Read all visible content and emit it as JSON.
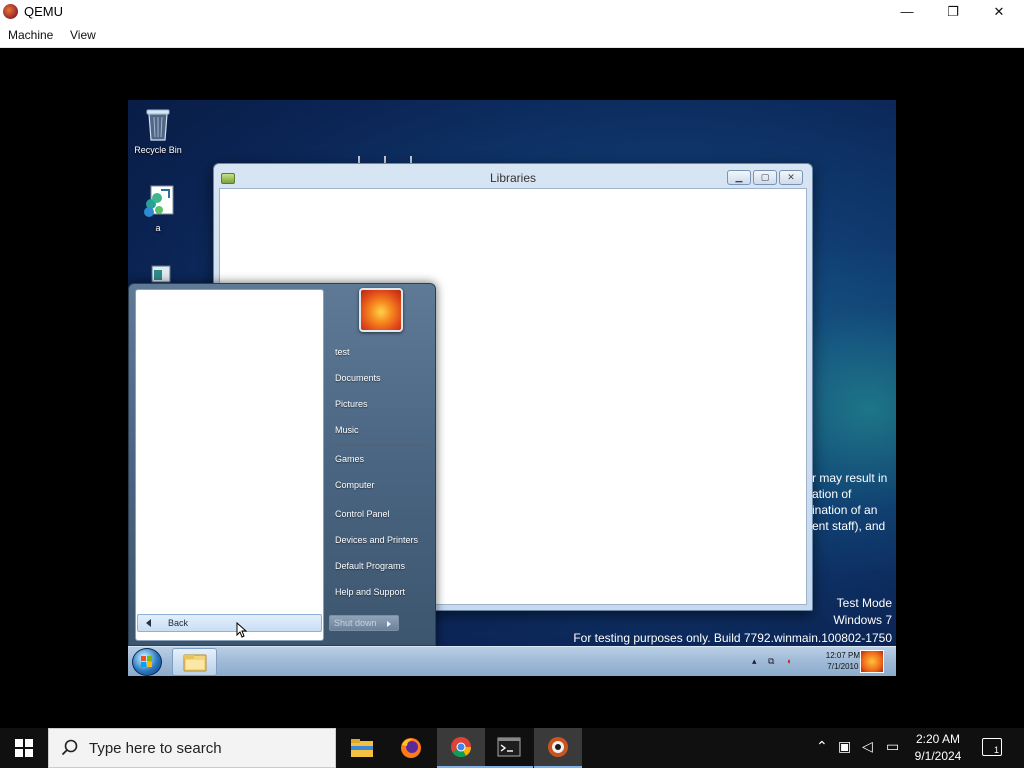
{
  "host_window": {
    "title": "QEMU",
    "menu": [
      "Machine",
      "View"
    ],
    "controls": {
      "minimize": "—",
      "restore": "❐",
      "close": "✕"
    }
  },
  "guest": {
    "desktop_icons": [
      {
        "label": "Recycle Bin",
        "icon": "recycle-bin-icon"
      },
      {
        "label": "a",
        "icon": "setup-package-icon"
      },
      {
        "label": "",
        "icon": "window-app-icon"
      }
    ],
    "libraries_window": {
      "title": "Libraries",
      "controls": {
        "minimize": "▁",
        "maximize": "▢",
        "close": "✕"
      }
    },
    "eula_lines": [
      "r may result in",
      "ation of",
      "ination of an",
      "ent staff), and"
    ],
    "watermark": {
      "line1": "Test Mode",
      "line2": "Windows 7",
      "line3": "For testing purposes only. Build 7792.winmain.100802-1750"
    },
    "start_menu": {
      "back_label": "Back",
      "items": [
        "test",
        "Documents",
        "Pictures",
        "Music",
        "Games",
        "Computer",
        "Control Panel",
        "Devices and Printers",
        "Default Programs",
        "Help and Support"
      ],
      "shutdown_label": "Shut down"
    },
    "taskbar": {
      "clock_time": "12:07 PM",
      "clock_date": "7/1/2010"
    }
  },
  "host_taskbar": {
    "search_placeholder": "Type here to search",
    "apps": [
      "file-explorer-icon",
      "firefox-icon",
      "chrome-icon",
      "terminal-icon",
      "qemu-icon"
    ],
    "clock_time": "2:20 AM",
    "clock_date": "9/1/2024",
    "notification_count": "1"
  },
  "colors": {
    "host_taskbar": "#101010",
    "guest_desktop": "#103c72",
    "start_menu": "#4a6582",
    "guest_taskbar": "#9fbad7"
  }
}
